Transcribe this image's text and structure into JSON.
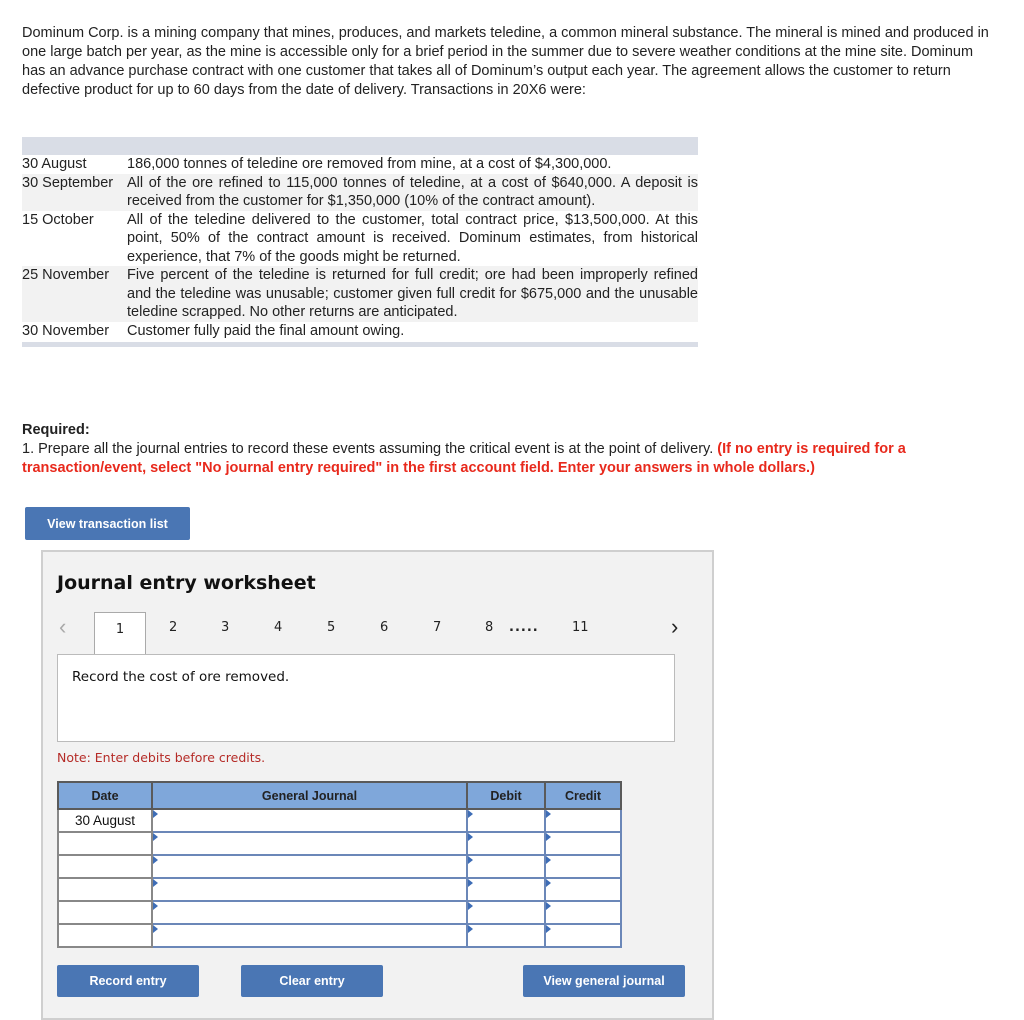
{
  "intro": "Dominum Corp. is a mining company that mines, produces, and markets teledine, a common mineral substance. The mineral is mined and produced in one large batch per year, as the mine is accessible only for a brief period in the summer due to severe weather conditions at the mine site. Dominum has an advance purchase contract with one customer that takes all of Dominum’s output each year. The agreement allows the customer to return defective product for up to 60 days from the date of delivery. Transactions in 20X6 were:",
  "transactions": [
    {
      "date": "30 August",
      "description": "186,000 tonnes of teledine ore removed from mine, at a cost of $4,300,000."
    },
    {
      "date": "30 September",
      "description": "All of the ore refined to 115,000 tonnes of teledine, at a cost of $640,000. A deposit is received from the customer for $1,350,000 (10% of the contract amount)."
    },
    {
      "date": "15 October",
      "description": "All of the teledine delivered to the customer, total contract price, $13,500,000. At this point, 50% of the contract amount is received. Dominum estimates, from historical experience, that 7% of the goods might be returned."
    },
    {
      "date": "25 November",
      "description": "Five percent of the teledine is returned for full credit; ore had been improperly refined and the teledine was unusable; customer given full credit for $675,000 and the unusable teledine scrapped. No other returns are anticipated."
    },
    {
      "date": "30 November",
      "description": "Customer fully paid the final amount owing."
    }
  ],
  "required": {
    "label": "Required:",
    "text": "1. Prepare all the journal entries to record these events assuming the critical event is at the point of delivery.",
    "instruction": "(If no entry is required for a transaction/event, select \"No journal entry required\" in the first account field. Enter your answers in whole dollars.)"
  },
  "buttons": {
    "view_transaction_list": "View transaction list",
    "record_entry": "Record entry",
    "clear_entry": "Clear entry",
    "view_general_journal": "View general journal"
  },
  "worksheet": {
    "title": "Journal entry worksheet",
    "pages": [
      "1",
      "2",
      "3",
      "4",
      "5",
      "6",
      "7",
      "8",
      ".....",
      "11"
    ],
    "active_page": "1",
    "prev_icon": "‹",
    "next_icon": "›",
    "prompt": "Record the cost of ore removed.",
    "note": "Note: Enter debits before credits.",
    "columns": [
      "Date",
      "General Journal",
      "Debit",
      "Credit"
    ],
    "rows": [
      {
        "date": "30 August",
        "account": "",
        "debit": "",
        "credit": ""
      },
      {
        "date": "",
        "account": "",
        "debit": "",
        "credit": ""
      },
      {
        "date": "",
        "account": "",
        "debit": "",
        "credit": ""
      },
      {
        "date": "",
        "account": "",
        "debit": "",
        "credit": ""
      },
      {
        "date": "",
        "account": "",
        "debit": "",
        "credit": ""
      },
      {
        "date": "",
        "account": "",
        "debit": "",
        "credit": ""
      }
    ]
  }
}
